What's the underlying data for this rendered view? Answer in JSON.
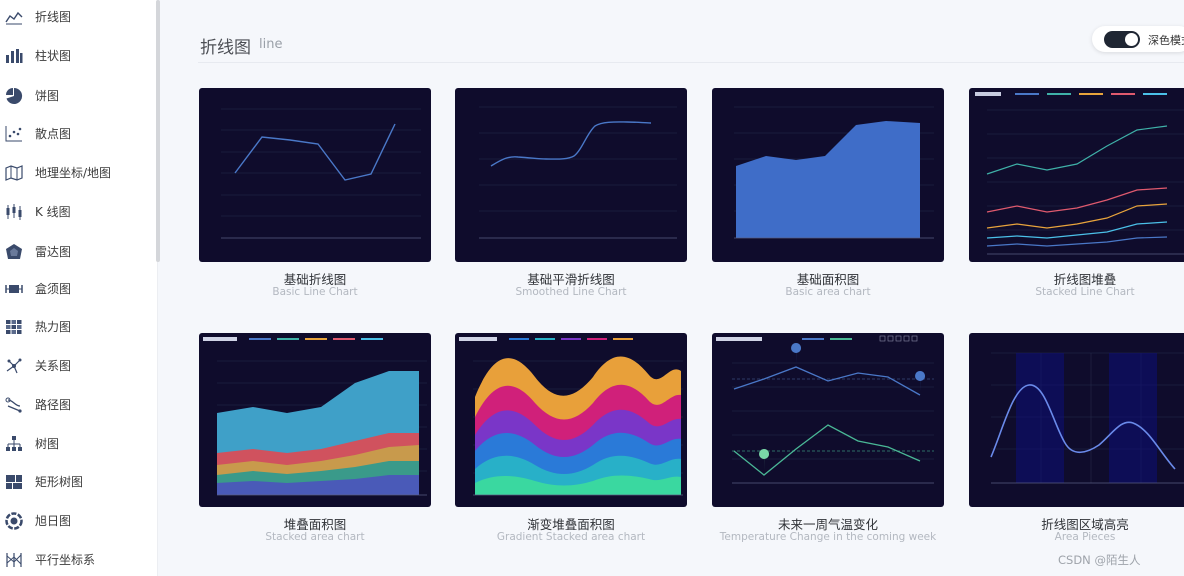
{
  "sidebar": {
    "items": [
      {
        "label": "折线图",
        "icon": "line-chart-icon"
      },
      {
        "label": "柱状图",
        "icon": "bar-chart-icon"
      },
      {
        "label": "饼图",
        "icon": "pie-chart-icon"
      },
      {
        "label": "散点图",
        "icon": "scatter-chart-icon"
      },
      {
        "label": "地理坐标/地图",
        "icon": "map-icon"
      },
      {
        "label": "K 线图",
        "icon": "candlestick-icon"
      },
      {
        "label": "雷达图",
        "icon": "radar-icon"
      },
      {
        "label": "盒须图",
        "icon": "boxplot-icon"
      },
      {
        "label": "热力图",
        "icon": "heatmap-icon"
      },
      {
        "label": "关系图",
        "icon": "graph-icon"
      },
      {
        "label": "路径图",
        "icon": "lines-icon"
      },
      {
        "label": "树图",
        "icon": "tree-icon"
      },
      {
        "label": "矩形树图",
        "icon": "treemap-icon"
      },
      {
        "label": "旭日图",
        "icon": "sunburst-icon"
      },
      {
        "label": "平行坐标系",
        "icon": "parallel-icon"
      }
    ]
  },
  "header": {
    "title": "折线图",
    "subtitle": "line",
    "toggle_label": "深色模式",
    "dark_mode": true
  },
  "cards": [
    {
      "title": "基础折线图",
      "subtitle": "Basic Line Chart"
    },
    {
      "title": "基础平滑折线图",
      "subtitle": "Smoothed Line Chart"
    },
    {
      "title": "基础面积图",
      "subtitle": "Basic area chart"
    },
    {
      "title": "折线图堆叠",
      "subtitle": "Stacked Line Chart"
    },
    {
      "title": "堆叠面积图",
      "subtitle": "Stacked area chart"
    },
    {
      "title": "渐变堆叠面积图",
      "subtitle": "Gradient Stacked area chart"
    },
    {
      "title": "未来一周气温变化",
      "subtitle": "Temperature Change in the coming week"
    },
    {
      "title": "折线图区域高亮",
      "subtitle": "Area Pieces"
    }
  ],
  "watermark": "CSDN @陌生人",
  "colors": {
    "thumb_bg": "#0f0c2c",
    "series_blue": "#4a78c8",
    "sidebar_icon": "#3a4a6b"
  }
}
